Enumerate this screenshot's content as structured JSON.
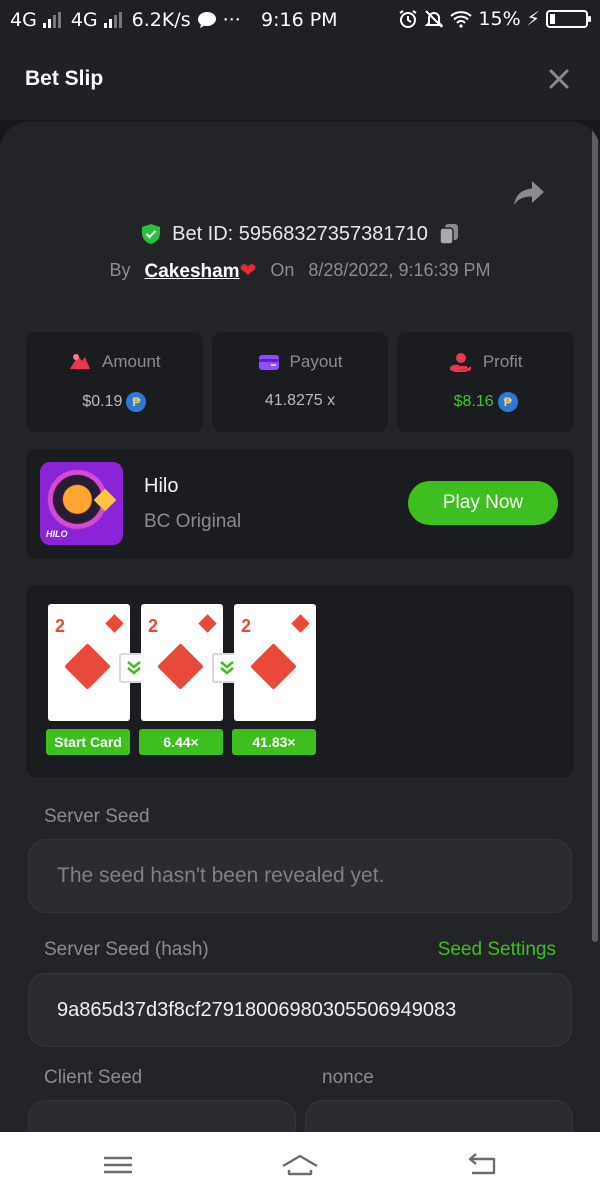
{
  "status_bar": {
    "network_1": "4G",
    "network_2": "4G",
    "speed": "6.2K/s",
    "more": "···",
    "time": "9:16 PM",
    "battery": "15%"
  },
  "header": {
    "title": "Bet Slip"
  },
  "bet": {
    "id_label": "Bet ID: 59568327357381710",
    "by_label": "By",
    "author": "Cakesham",
    "on_label": "On",
    "date": "8/28/2022, 9:16:39 PM"
  },
  "stats": {
    "amount": {
      "label": "Amount",
      "value": "$0.19"
    },
    "payout": {
      "label": "Payout",
      "value": "41.8275 x"
    },
    "profit": {
      "label": "Profit",
      "value": "$8.16"
    },
    "coin_symbol": "₱"
  },
  "game": {
    "name": "Hilo",
    "provider": "BC Original",
    "play_label": "Play Now",
    "thumb_label": "HILO"
  },
  "cards": [
    {
      "rank": "2",
      "label": "Start Card"
    },
    {
      "rank": "2",
      "label": "6.44×"
    },
    {
      "rank": "2",
      "label": "41.83×"
    }
  ],
  "server_seed": {
    "label": "Server Seed",
    "value": "The seed hasn't been revealed yet."
  },
  "server_seed_hash": {
    "label": "Server Seed (hash)",
    "settings_link": "Seed Settings",
    "value": "9a865d37d3f8cf27918006980305506949083"
  },
  "client_seed": {
    "label": "Client Seed"
  },
  "nonce": {
    "label": "nonce"
  }
}
